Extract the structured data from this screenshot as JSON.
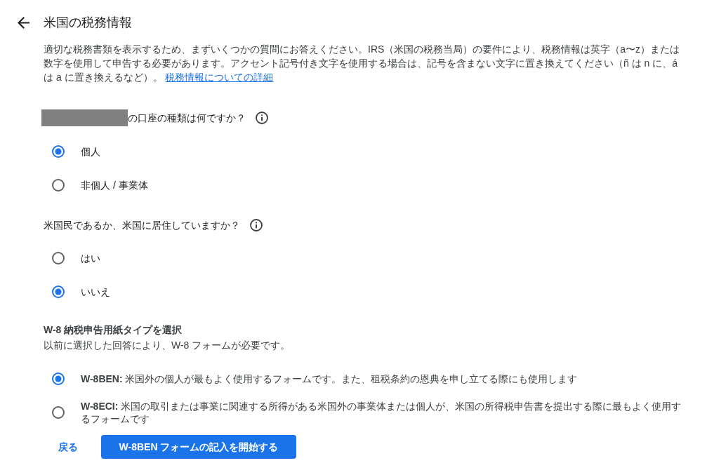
{
  "header": {
    "title": "米国の税務情報"
  },
  "intro": {
    "text": "適切な税務書類を表示するため、まずいくつかの質問にお答えください。IRS（米国の税務当局）の要件により、税務情報は英字（a〜z）または数字を使用して申告する必要があります。アクセント記号付き文字を使用する場合は、記号を含まない文字に置き換えてください（ñ は n に、á は a に置き換えるなど）。",
    "link": "税務情報についての詳細"
  },
  "questions": [
    {
      "redacted_prefix": true,
      "text": "の口座の種類は何ですか？",
      "options": [
        {
          "label": "個人",
          "selected": true
        },
        {
          "label": "非個人 / 事業体",
          "selected": false
        }
      ]
    },
    {
      "redacted_prefix": false,
      "text": "米国民であるか、米国に居住していますか？",
      "options": [
        {
          "label": "はい",
          "selected": false
        },
        {
          "label": "いいえ",
          "selected": true
        }
      ]
    }
  ],
  "form_type": {
    "title": "W-8 納税申告用紙タイプを選択",
    "subtitle": "以前に選択した回答により、W-8 フォームが必要です。",
    "options": [
      {
        "label": "**W-8BEN:** 米国外の個人が最もよく使用するフォームです。また、租税条約の恩典を申し立てる際にも使用します",
        "selected": true
      },
      {
        "label": "**W-8ECI:** 米国の取引または事業に関連する所得がある米国外の事業体または個人が、米国の所得税申告書を提出する際に最もよく使用するフォームです",
        "selected": false
      }
    ]
  },
  "actions": [
    {
      "kind": "text",
      "label": "戻る"
    },
    {
      "kind": "primary",
      "label": "W-8BEN フォームの記入を開始する"
    }
  ]
}
